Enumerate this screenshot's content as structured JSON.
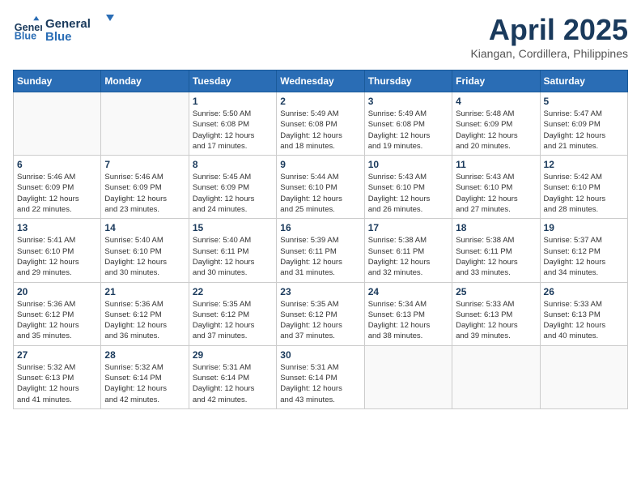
{
  "header": {
    "logo_line1": "General",
    "logo_line2": "Blue",
    "month": "April 2025",
    "location": "Kiangan, Cordillera, Philippines"
  },
  "weekdays": [
    "Sunday",
    "Monday",
    "Tuesday",
    "Wednesday",
    "Thursday",
    "Friday",
    "Saturday"
  ],
  "weeks": [
    [
      {
        "day": "",
        "detail": ""
      },
      {
        "day": "",
        "detail": ""
      },
      {
        "day": "1",
        "detail": "Sunrise: 5:50 AM\nSunset: 6:08 PM\nDaylight: 12 hours\nand 17 minutes."
      },
      {
        "day": "2",
        "detail": "Sunrise: 5:49 AM\nSunset: 6:08 PM\nDaylight: 12 hours\nand 18 minutes."
      },
      {
        "day": "3",
        "detail": "Sunrise: 5:49 AM\nSunset: 6:08 PM\nDaylight: 12 hours\nand 19 minutes."
      },
      {
        "day": "4",
        "detail": "Sunrise: 5:48 AM\nSunset: 6:09 PM\nDaylight: 12 hours\nand 20 minutes."
      },
      {
        "day": "5",
        "detail": "Sunrise: 5:47 AM\nSunset: 6:09 PM\nDaylight: 12 hours\nand 21 minutes."
      }
    ],
    [
      {
        "day": "6",
        "detail": "Sunrise: 5:46 AM\nSunset: 6:09 PM\nDaylight: 12 hours\nand 22 minutes."
      },
      {
        "day": "7",
        "detail": "Sunrise: 5:46 AM\nSunset: 6:09 PM\nDaylight: 12 hours\nand 23 minutes."
      },
      {
        "day": "8",
        "detail": "Sunrise: 5:45 AM\nSunset: 6:09 PM\nDaylight: 12 hours\nand 24 minutes."
      },
      {
        "day": "9",
        "detail": "Sunrise: 5:44 AM\nSunset: 6:10 PM\nDaylight: 12 hours\nand 25 minutes."
      },
      {
        "day": "10",
        "detail": "Sunrise: 5:43 AM\nSunset: 6:10 PM\nDaylight: 12 hours\nand 26 minutes."
      },
      {
        "day": "11",
        "detail": "Sunrise: 5:43 AM\nSunset: 6:10 PM\nDaylight: 12 hours\nand 27 minutes."
      },
      {
        "day": "12",
        "detail": "Sunrise: 5:42 AM\nSunset: 6:10 PM\nDaylight: 12 hours\nand 28 minutes."
      }
    ],
    [
      {
        "day": "13",
        "detail": "Sunrise: 5:41 AM\nSunset: 6:10 PM\nDaylight: 12 hours\nand 29 minutes."
      },
      {
        "day": "14",
        "detail": "Sunrise: 5:40 AM\nSunset: 6:10 PM\nDaylight: 12 hours\nand 30 minutes."
      },
      {
        "day": "15",
        "detail": "Sunrise: 5:40 AM\nSunset: 6:11 PM\nDaylight: 12 hours\nand 30 minutes."
      },
      {
        "day": "16",
        "detail": "Sunrise: 5:39 AM\nSunset: 6:11 PM\nDaylight: 12 hours\nand 31 minutes."
      },
      {
        "day": "17",
        "detail": "Sunrise: 5:38 AM\nSunset: 6:11 PM\nDaylight: 12 hours\nand 32 minutes."
      },
      {
        "day": "18",
        "detail": "Sunrise: 5:38 AM\nSunset: 6:11 PM\nDaylight: 12 hours\nand 33 minutes."
      },
      {
        "day": "19",
        "detail": "Sunrise: 5:37 AM\nSunset: 6:12 PM\nDaylight: 12 hours\nand 34 minutes."
      }
    ],
    [
      {
        "day": "20",
        "detail": "Sunrise: 5:36 AM\nSunset: 6:12 PM\nDaylight: 12 hours\nand 35 minutes."
      },
      {
        "day": "21",
        "detail": "Sunrise: 5:36 AM\nSunset: 6:12 PM\nDaylight: 12 hours\nand 36 minutes."
      },
      {
        "day": "22",
        "detail": "Sunrise: 5:35 AM\nSunset: 6:12 PM\nDaylight: 12 hours\nand 37 minutes."
      },
      {
        "day": "23",
        "detail": "Sunrise: 5:35 AM\nSunset: 6:12 PM\nDaylight: 12 hours\nand 37 minutes."
      },
      {
        "day": "24",
        "detail": "Sunrise: 5:34 AM\nSunset: 6:13 PM\nDaylight: 12 hours\nand 38 minutes."
      },
      {
        "day": "25",
        "detail": "Sunrise: 5:33 AM\nSunset: 6:13 PM\nDaylight: 12 hours\nand 39 minutes."
      },
      {
        "day": "26",
        "detail": "Sunrise: 5:33 AM\nSunset: 6:13 PM\nDaylight: 12 hours\nand 40 minutes."
      }
    ],
    [
      {
        "day": "27",
        "detail": "Sunrise: 5:32 AM\nSunset: 6:13 PM\nDaylight: 12 hours\nand 41 minutes."
      },
      {
        "day": "28",
        "detail": "Sunrise: 5:32 AM\nSunset: 6:14 PM\nDaylight: 12 hours\nand 42 minutes."
      },
      {
        "day": "29",
        "detail": "Sunrise: 5:31 AM\nSunset: 6:14 PM\nDaylight: 12 hours\nand 42 minutes."
      },
      {
        "day": "30",
        "detail": "Sunrise: 5:31 AM\nSunset: 6:14 PM\nDaylight: 12 hours\nand 43 minutes."
      },
      {
        "day": "",
        "detail": ""
      },
      {
        "day": "",
        "detail": ""
      },
      {
        "day": "",
        "detail": ""
      }
    ]
  ]
}
